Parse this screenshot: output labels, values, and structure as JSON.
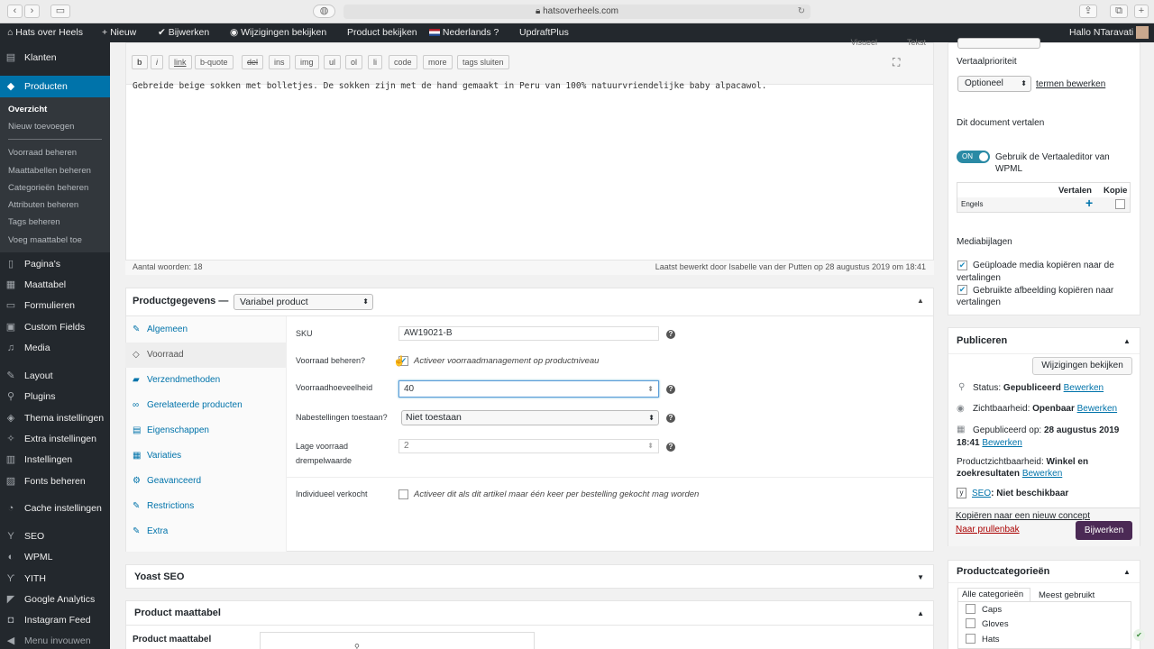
{
  "browser": {
    "url": "hatsoverheels.com",
    "back": "‹",
    "forward": "›"
  },
  "adminbar": {
    "site": "Hats over Heels",
    "new": "Nieuw",
    "update": "Bijwerken",
    "view_changes": "Wijzigingen bekijken",
    "view_product": "Product bekijken",
    "language": "Nederlands",
    "updraft": "UpdraftPlus",
    "greeting": "Hallo NTaravati"
  },
  "sidebar": {
    "klanten": "Klanten",
    "producten": "Producten",
    "sub": [
      "Overzicht",
      "Nieuw toevoegen",
      "Voorraad beheren",
      "Maattabellen beheren",
      "Categorieën beheren",
      "Attributen beheren",
      "Tags beheren",
      "Voeg maattabel toe"
    ],
    "items": [
      "Pagina's",
      "Maattabel",
      "Formulieren",
      "Custom Fields",
      "Media",
      "Layout",
      "Plugins",
      "Thema instellingen",
      "Extra instellingen",
      "Instellingen",
      "Fonts beheren",
      "Cache instellingen",
      "SEO",
      "WPML",
      "YITH",
      "Google Analytics",
      "Instagram Feed",
      "Menu invouwen"
    ]
  },
  "editor": {
    "top_tabs": [
      "Visueel",
      "Tekst"
    ],
    "quicktags": [
      "b",
      "i",
      "link",
      "b-quote",
      "del",
      "ins",
      "img",
      "ul",
      "ol",
      "li",
      "code",
      "more",
      "tags sluiten"
    ],
    "content": "Gebreide beige sokken met bolletjes. De sokken zijn met de hand gemaakt in Peru van 100% natuurvriendelijke baby alpacawol.",
    "word_count": "Aantal woorden: 18",
    "last_edit": "Laatst bewerkt door Isabelle van der Putten op 28 augustus 2019 om 18:41"
  },
  "product_data": {
    "title": "Productgegevens —",
    "type": "Variabel product",
    "tabs": [
      "Algemeen",
      "Voorraad",
      "Verzendmethoden",
      "Gerelateerde producten",
      "Eigenschappen",
      "Variaties",
      "Geavanceerd",
      "Restrictions",
      "Extra"
    ],
    "sku_label": "SKU",
    "sku": "AW19021-B",
    "manage_label": "Voorraad beheren?",
    "manage_text": "Activeer voorraadmanagement op productniveau",
    "qty_label": "Voorraadhoeveelheid",
    "qty": "40",
    "backorder_label": "Nabestellingen toestaan?",
    "backorder": "Niet toestaan",
    "low_label_1": "Lage voorraad",
    "low_label_2": "drempelwaarde",
    "low": "2",
    "sold_label": "Individueel verkocht",
    "sold_text": "Activeer dit als dit artikel maar één keer per bestelling gekocht mag worden"
  },
  "yoast": {
    "title": "Yoast SEO"
  },
  "size_chart": {
    "title": "Product maattabel",
    "label": "Product maattabel"
  },
  "right": {
    "priority_label": "Vertaalprioriteit",
    "priority": "Optioneel",
    "edit_terms": "termen bewerken",
    "translate_title": "Dit document vertalen",
    "toggle": "ON",
    "toggle_text_1": "Gebruik de Vertaaleditor van",
    "toggle_text_2": "WPML",
    "col_translate": "Vertalen",
    "col_copy": "Kopie",
    "lang_en": "Engels",
    "plus": "+",
    "media_title": "Mediabijlagen",
    "media1_a": "Geüploade media kopiëren naar de",
    "media1_b": "vertalingen",
    "media2_a": "Gebruikte afbeelding kopiëren naar",
    "media2_b": "vertalingen",
    "publish_title": "Publiceren",
    "preview_btn": "Wijzigingen bekijken",
    "status_label": "Status:",
    "status": "Gepubliceerd",
    "edit": "Bewerken",
    "visibility_label": "Zichtbaarheid:",
    "visibility": "Openbaar",
    "published_label": "Gepubliceerd op:",
    "published_date": "28 augustus 2019",
    "published_time": "18:41",
    "catalog_label": "Productzichtbaarheid:",
    "catalog_1": "Winkel en",
    "catalog_2": "zoekresultaten",
    "seo_label": "SEO",
    "seo_status": ": Niet beschikbaar",
    "copy_link": "Kopiëren naar een nieuw concept",
    "trash_link": "Naar prullenbak",
    "update_btn": "Bijwerken",
    "cats_title": "Productcategorieën",
    "cat_tab_all": "Alle categorieën",
    "cat_tab_most": "Meest gebruikt",
    "cats": [
      "Caps",
      "Gloves",
      "Hats"
    ]
  }
}
